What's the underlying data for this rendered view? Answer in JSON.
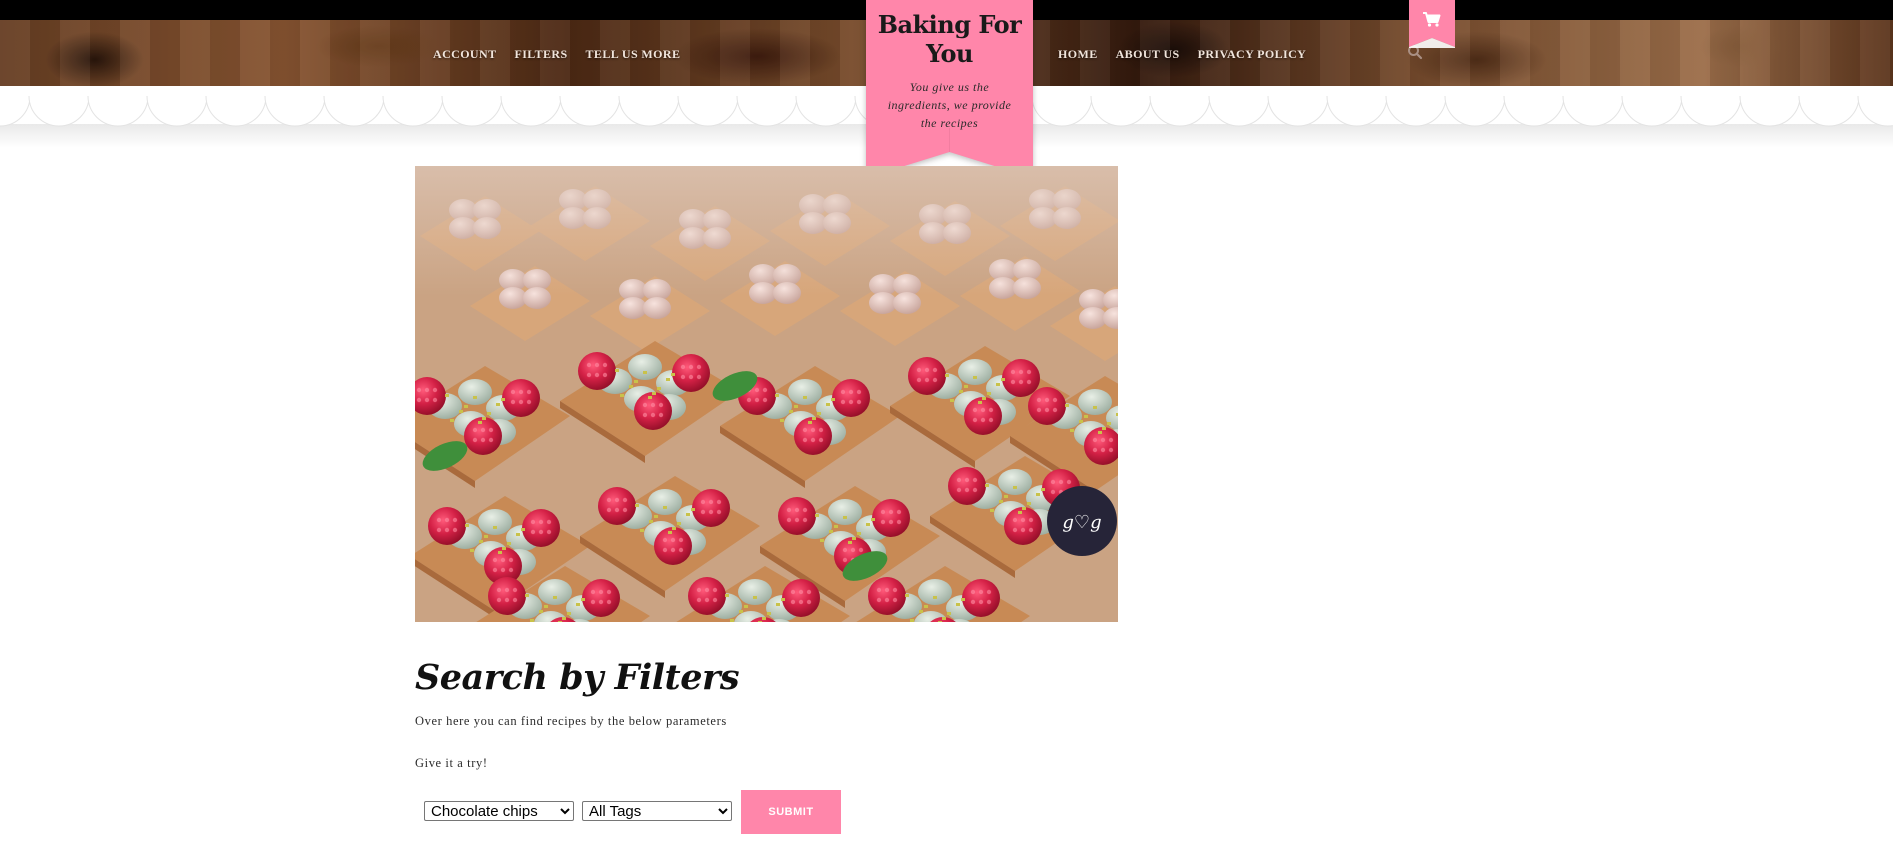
{
  "colors": {
    "accent_pink": "#ff86aa",
    "top_strip": "#000000",
    "nav_text": "#f1e5dc"
  },
  "nav": {
    "left": [
      {
        "label": "ACCOUNT"
      },
      {
        "label": "FILTERS"
      },
      {
        "label": "TELL US MORE"
      }
    ],
    "right": [
      {
        "label": "HOME"
      },
      {
        "label": "ABOUT US"
      },
      {
        "label": "PRIVACY POLICY"
      }
    ],
    "search_icon": "search-icon",
    "cart_icon": "shopping-cart-icon"
  },
  "logo": {
    "title": "Baking For You",
    "tagline": "You give us the ingredients, we provide the recipes"
  },
  "hero": {
    "image_description_icon": "dessert-photo",
    "watermark": "g♡g"
  },
  "main": {
    "heading": "Search by Filters",
    "paragraph_1": "Over here you can find recipes by the below parameters",
    "paragraph_2": "Give it a try!"
  },
  "form": {
    "ingredient_selected": "Chocolate chips",
    "tag_selected": "All Tags",
    "submit_label": "SUBMIT"
  }
}
